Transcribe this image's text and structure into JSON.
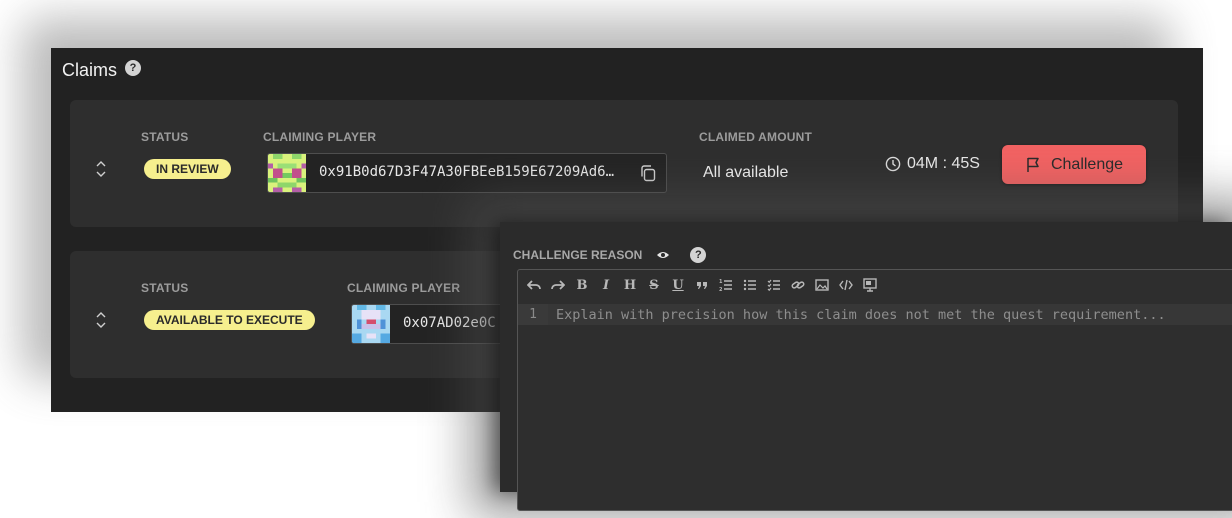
{
  "panel": {
    "title": "Claims",
    "help_icon": "?"
  },
  "claims": [
    {
      "status_label": "STATUS",
      "status": "IN REVIEW",
      "player_label": "CLAIMING PLAYER",
      "player_address": "0x91B0d67D3F47A30FBEeB159E67209Ad6…",
      "amount_label": "CLAIMED AMOUNT",
      "amount": "All available",
      "timer_minutes": "04",
      "timer_minutes_unit": "M",
      "timer_sep": ":",
      "timer_seconds": "45",
      "timer_seconds_unit": "S",
      "challenge_label": "Challenge"
    },
    {
      "status_label": "STATUS",
      "status": "AVAILABLE TO EXECUTE",
      "player_label": "CLAIMING PLAYER",
      "player_address": "0x07AD02e0C"
    }
  ],
  "dialog": {
    "label": "CHALLENGE REASON",
    "help_icon": "?",
    "line_number": "1",
    "placeholder": "Explain with precision how this claim does not met the quest requirement...",
    "toolbar": [
      "undo-icon",
      "redo-icon",
      "bold-icon",
      "italic-icon",
      "heading-icon",
      "strikethrough-icon",
      "underline-icon",
      "quote-icon",
      "ordered-list-icon",
      "unordered-list-icon",
      "checklist-icon",
      "link-icon",
      "image-icon",
      "code-icon",
      "preview-icon"
    ]
  },
  "colors": {
    "badge": "#f6ef8e",
    "challenge": "#f26262",
    "panel": "#222222",
    "card": "#2e2e2e"
  }
}
